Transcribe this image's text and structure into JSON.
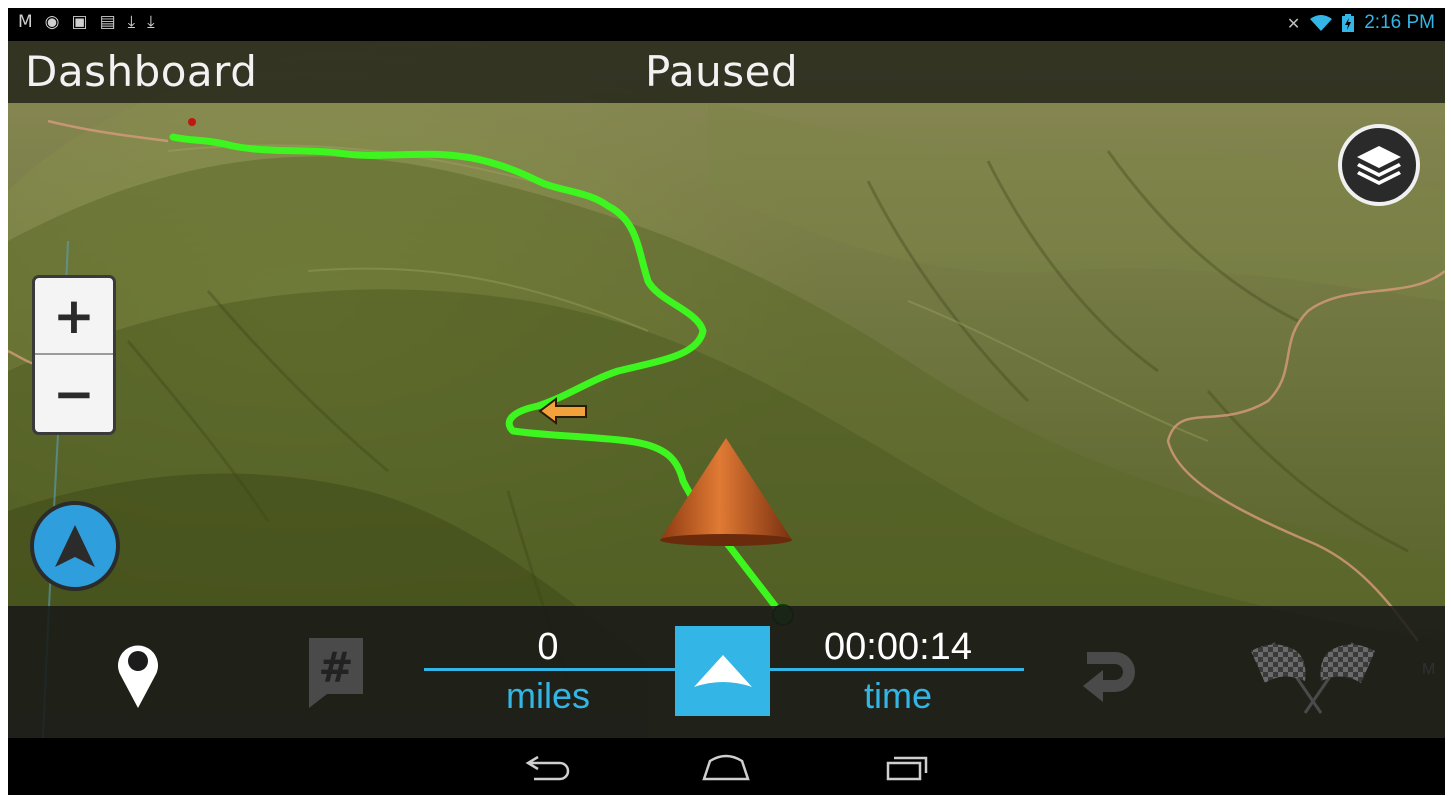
{
  "status_bar": {
    "left_icons": [
      "gmail-icon",
      "gps-icon",
      "image-icon",
      "sd-card-icon",
      "download-icon",
      "download-icon"
    ],
    "time": "2:16 PM"
  },
  "header": {
    "title": "Dashboard",
    "state": "Paused"
  },
  "map": {
    "edge_label": "M"
  },
  "stats": {
    "distance_value": "0",
    "distance_label": "miles",
    "time_value": "00:00:14",
    "time_label": "time"
  },
  "colors": {
    "accent": "#33b5e5",
    "track": "#39f21c",
    "terrain": "#6e7a3c"
  }
}
